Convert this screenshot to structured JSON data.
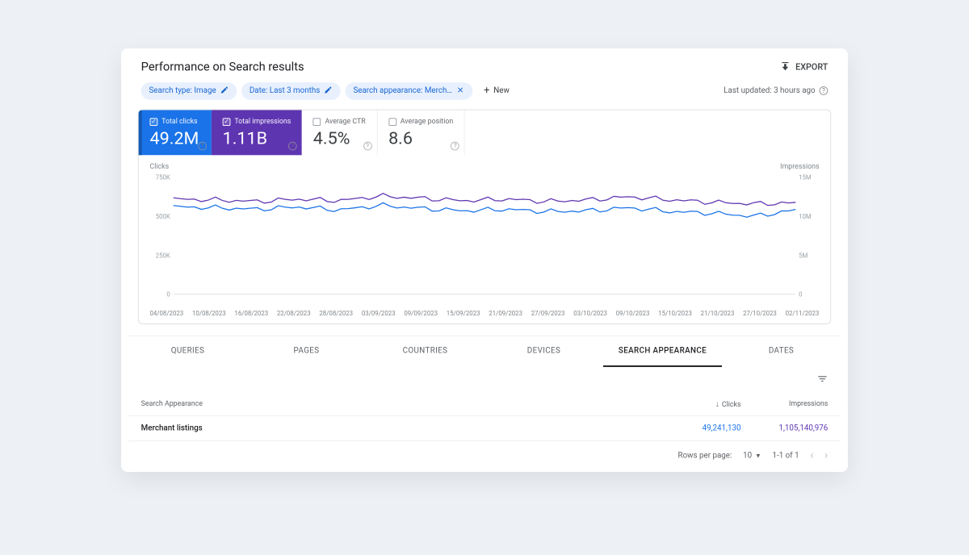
{
  "header": {
    "title": "Performance on Search results",
    "export": "EXPORT"
  },
  "filters": {
    "chips": [
      {
        "label": "Search type: Image",
        "closable": false
      },
      {
        "label": "Date: Last 3 months",
        "closable": false
      },
      {
        "label": "Search appearance: Merch…",
        "closable": true
      }
    ],
    "new": "New",
    "last_updated": "Last updated: 3 hours ago"
  },
  "metrics": {
    "clicks": {
      "label": "Total clicks",
      "value": "49.2M",
      "checked": true
    },
    "impressions": {
      "label": "Total impressions",
      "value": "1.11B",
      "checked": true
    },
    "ctr": {
      "label": "Average CTR",
      "value": "4.5%",
      "checked": false
    },
    "position": {
      "label": "Average position",
      "value": "8.6",
      "checked": false
    }
  },
  "chart_data": {
    "type": "line",
    "x": [
      "04/08/2023",
      "10/08/2023",
      "16/08/2023",
      "22/08/2023",
      "28/08/2023",
      "03/09/2023",
      "09/09/2023",
      "15/09/2023",
      "21/09/2023",
      "27/09/2023",
      "03/10/2023",
      "09/10/2023",
      "15/10/2023",
      "21/10/2023",
      "27/10/2023",
      "02/11/2023"
    ],
    "series": [
      {
        "name": "Clicks",
        "axis": "left",
        "color": "#1a73e8",
        "values": [
          560000,
          555000,
          545000,
          560000,
          540000,
          570000,
          550000,
          535000,
          545000,
          530000,
          535000,
          555000,
          530000,
          520000,
          500000,
          540000
        ]
      },
      {
        "name": "Impressions",
        "axis": "right",
        "color": "#5e35b1",
        "values": [
          12200000,
          12100000,
          11900000,
          12200000,
          12000000,
          12600000,
          12300000,
          12000000,
          12200000,
          11900000,
          12100000,
          12500000,
          12100000,
          11800000,
          11600000,
          11700000
        ]
      }
    ],
    "ylabel_left": "Clicks",
    "ylabel_right": "Impressions",
    "yticks_left": [
      "750K",
      "500K",
      "250K",
      "0"
    ],
    "yticks_right": [
      "15M",
      "10M",
      "5M",
      "0"
    ],
    "ylim_left": [
      0,
      750000
    ],
    "ylim_right": [
      0,
      15000000
    ]
  },
  "tabs": [
    "QUERIES",
    "PAGES",
    "COUNTRIES",
    "DEVICES",
    "SEARCH APPEARANCE",
    "DATES"
  ],
  "active_tab": 4,
  "table": {
    "col_name": "Search Appearance",
    "col_clicks": "Clicks",
    "col_impressions": "Impressions",
    "rows": [
      {
        "name": "Merchant listings",
        "clicks": "49,241,130",
        "impressions": "1,105,140,976"
      }
    ]
  },
  "pager": {
    "rows_label": "Rows per page:",
    "rows_value": "10",
    "range": "1-1 of 1"
  }
}
